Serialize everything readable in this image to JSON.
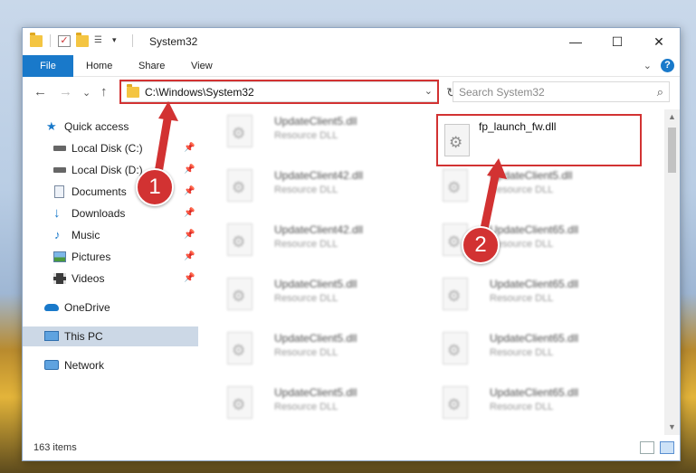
{
  "window": {
    "title": "System32",
    "controls": {
      "minimize": "—",
      "maximize": "☐",
      "close": "✕"
    }
  },
  "ribbon": {
    "tabs": [
      "File",
      "Home",
      "Share",
      "View"
    ],
    "collapse_glyph": "⌄",
    "help_glyph": "?"
  },
  "nav": {
    "back": "←",
    "forward": "→",
    "recent": "⌄",
    "up": "↑"
  },
  "address": {
    "path": "C:\\Windows\\System32",
    "dropdown_glyph": "⌄",
    "refresh_glyph": "↻"
  },
  "search": {
    "placeholder": "Search System32",
    "icon": "⌕"
  },
  "sidebar": {
    "items": [
      {
        "label": "Quick access",
        "icon": "star-icon"
      },
      {
        "label": "Local Disk (C:)",
        "icon": "drive-icon",
        "pinned": true
      },
      {
        "label": "Local Disk (D:)",
        "icon": "drive-icon",
        "pinned": true
      },
      {
        "label": "Documents",
        "icon": "documents-icon",
        "pinned": true
      },
      {
        "label": "Downloads",
        "icon": "downloads-icon",
        "pinned": true
      },
      {
        "label": "Music",
        "icon": "music-icon",
        "pinned": true
      },
      {
        "label": "Pictures",
        "icon": "pictures-icon",
        "pinned": true
      },
      {
        "label": "Videos",
        "icon": "videos-icon",
        "pinned": true
      },
      {
        "label": "OneDrive",
        "icon": "onedrive-icon"
      },
      {
        "label": "This PC",
        "icon": "pc-icon",
        "selected": true
      },
      {
        "label": "Network",
        "icon": "network-icon"
      }
    ]
  },
  "files": {
    "highlighted": {
      "name": "fp_launch_fw.dll",
      "type": ""
    },
    "left_column": [
      {
        "name": "UpdateClient5.dll",
        "type": "Resource DLL"
      },
      {
        "name": "UpdateClient42.dll",
        "type": "Resource DLL"
      },
      {
        "name": "UpdateClient42.dll",
        "type": "Resource DLL"
      },
      {
        "name": "UpdateClient5.dll",
        "type": "Resource DLL"
      },
      {
        "name": "UpdateClient5.dll",
        "type": "Resource DLL"
      },
      {
        "name": "UpdateClient5.dll",
        "type": "Resource DLL"
      }
    ],
    "right_column": [
      {
        "name": "UpdateClient5.dll",
        "type": "Resource DLL"
      },
      {
        "name": "UpdateClient65.dll",
        "type": "Resource DLL"
      },
      {
        "name": "UpdateClient65.dll",
        "type": "Resource DLL"
      },
      {
        "name": "UpdateClient65.dll",
        "type": "Resource DLL"
      },
      {
        "name": "UpdateClient65.dll",
        "type": "Resource DLL"
      }
    ]
  },
  "status": {
    "item_count": "163 items"
  },
  "annotations": {
    "step1": "1",
    "step2": "2",
    "color": "#d23232"
  }
}
